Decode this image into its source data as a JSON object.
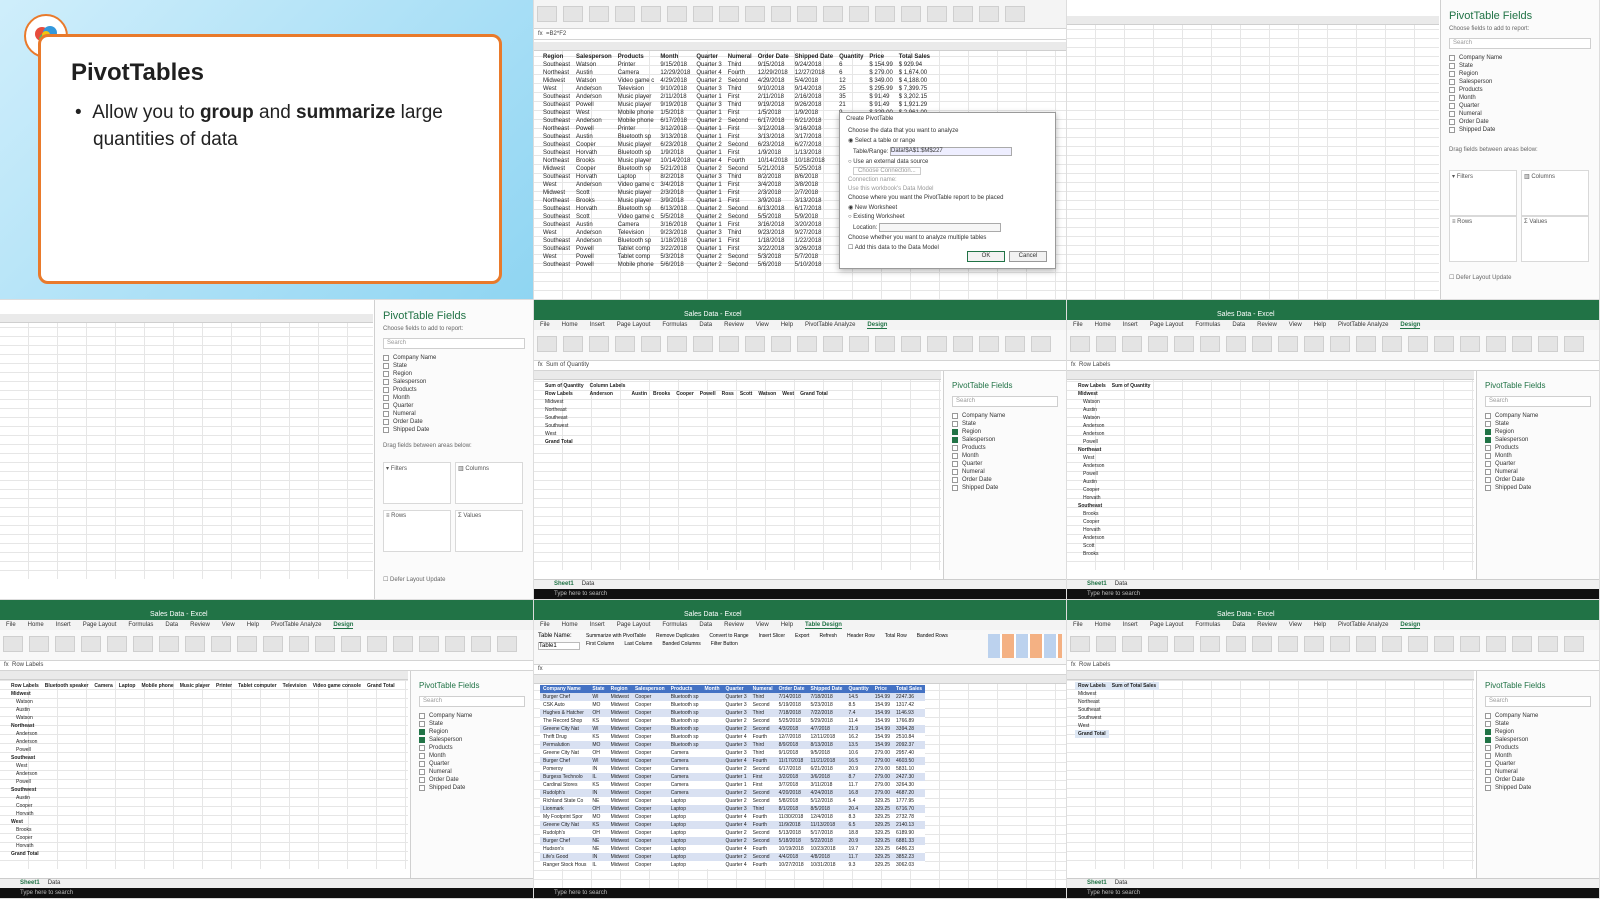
{
  "slide": {
    "title": "PivotTables",
    "bullet_pre": "Allow you to ",
    "bullet_b1": "group",
    "bullet_mid": " and ",
    "bullet_b2": "summarize",
    "bullet_post": " large quantities of data"
  },
  "excel": {
    "title_sales": "Sales Data - Excel",
    "formula_value": "=B2*F2",
    "formula_sum": "Sum of Quantity",
    "formula_rl": "Row Labels",
    "menu": [
      "File",
      "Home",
      "Insert",
      "Page Layout",
      "Formulas",
      "Data",
      "Review",
      "View",
      "Help",
      "PivotTable Analyze",
      "Design"
    ],
    "menu_table": [
      "File",
      "Home",
      "Insert",
      "Page Layout",
      "Formulas",
      "Data",
      "Review",
      "View",
      "Help",
      "Table Design"
    ],
    "sheet_tabs": [
      "Sheet1",
      "Data"
    ],
    "taskbar_search": "Type here to search"
  },
  "panel": {
    "title": "PivotTable Fields",
    "subtitle": "Choose fields to add to report:",
    "search": "Search",
    "fields": [
      "Company Name",
      "State",
      "Region",
      "Salesperson",
      "Products",
      "Month",
      "Quarter",
      "Numeral",
      "Order Date",
      "Shipped Date"
    ],
    "areas": {
      "filters": "Filters",
      "columns": "Columns",
      "rows": "Rows",
      "values": "Values"
    },
    "drag": "Drag fields between areas below:",
    "defer": "Defer Layout Update",
    "update": "Update"
  },
  "data_table": {
    "headers": [
      "Region",
      "Salesperson",
      "Products",
      "Month",
      "Quarter",
      "Numeral",
      "Order Date",
      "Shipped Date",
      "Quantity",
      "Price",
      "Total Sales"
    ],
    "rows": [
      [
        "Southeast",
        "Watson",
        "Printer",
        "9/15/2018",
        "Quarter 3",
        "Third",
        "9/15/2018",
        "9/24/2018",
        "6",
        "$ 154.99",
        "$ 929.94"
      ],
      [
        "Northeast",
        "Austin",
        "Camera",
        "12/29/2018",
        "Quarter 4",
        "Fourth",
        "12/29/2018",
        "12/27/2018",
        "6",
        "$ 279.00",
        "$ 1,674.00"
      ],
      [
        "Midwest",
        "Watson",
        "Video game c",
        "4/29/2018",
        "Quarter 2",
        "Second",
        "4/29/2018",
        "5/4/2018",
        "12",
        "$ 349.00",
        "$ 4,188.00"
      ],
      [
        "West",
        "Anderson",
        "Television",
        "9/10/2018",
        "Quarter 3",
        "Third",
        "9/10/2018",
        "9/14/2018",
        "25",
        "$ 295.99",
        "$ 7,399.75"
      ],
      [
        "Southeast",
        "Anderson",
        "Music player",
        "2/11/2018",
        "Quarter 1",
        "First",
        "2/11/2018",
        "2/16/2018",
        "35",
        "$ 91.49",
        "$ 3,202.15"
      ],
      [
        "Southeast",
        "Powell",
        "Music player",
        "9/19/2018",
        "Quarter 3",
        "Third",
        "9/19/2018",
        "9/26/2018",
        "21",
        "$ 91.49",
        "$ 1,921.29"
      ],
      [
        "Southeast",
        "West",
        "Mobile phone",
        "1/5/2018",
        "Quarter 1",
        "First",
        "1/5/2018",
        "1/9/2018",
        "9",
        "$ 329.00",
        "$ 2,961.00"
      ],
      [
        "Southeast",
        "Anderson",
        "Mobile phone",
        "6/17/2018",
        "Quarter 2",
        "Second",
        "6/17/2018",
        "6/21/2018",
        "14",
        "$ 329.00",
        "$ 4,606.00"
      ],
      [
        "Northeast",
        "Powell",
        "Printer",
        "3/12/2018",
        "Quarter 1",
        "First",
        "3/12/2018",
        "3/16/2018",
        "18",
        "$ 154.99",
        "$ 2,789.82"
      ],
      [
        "Southeast",
        "Austin",
        "Bluetooth sp",
        "3/13/2018",
        "Quarter 1",
        "First",
        "3/13/2018",
        "3/17/2018",
        "7",
        "$ 54.99",
        "$ 384.93"
      ],
      [
        "Southeast",
        "Cooper",
        "Music player",
        "6/23/2018",
        "Quarter 2",
        "Second",
        "6/23/2018",
        "6/27/2018",
        "11",
        "$ 91.49",
        "$ 1,006.39"
      ],
      [
        "Southeast",
        "Horvath",
        "Bluetooth sp",
        "1/9/2018",
        "Quarter 1",
        "First",
        "1/9/2018",
        "1/13/2018",
        "15",
        "$ 54.99",
        "$ 824.85"
      ],
      [
        "Northeast",
        "Brooks",
        "Music player",
        "10/14/2018",
        "Quarter 4",
        "Fourth",
        "10/14/2018",
        "10/18/2018",
        "20",
        "$ 91.49",
        "$ 1,829.80"
      ],
      [
        "Midwest",
        "Cooper",
        "Bluetooth sp",
        "5/21/2018",
        "Quarter 2",
        "Second",
        "5/21/2018",
        "5/25/2018",
        "8",
        "$ 54.99",
        "$ 439.92"
      ],
      [
        "Southeast",
        "Horvath",
        "Laptop",
        "8/2/2018",
        "Quarter 3",
        "Third",
        "8/2/2018",
        "8/6/2018",
        "4",
        "$ 629.00",
        "$ 2,516.00"
      ],
      [
        "West",
        "Anderson",
        "Video game c",
        "3/4/2018",
        "Quarter 1",
        "First",
        "3/4/2018",
        "3/8/2018",
        "10",
        "$ 349.00",
        "$ 3,490.00"
      ],
      [
        "Midwest",
        "Scott",
        "Music player",
        "2/3/2018",
        "Quarter 1",
        "First",
        "2/3/2018",
        "2/7/2018",
        "13",
        "$ 91.49",
        "$ 1,189.37"
      ],
      [
        "Northeast",
        "Brooks",
        "Music player",
        "3/9/2018",
        "Quarter 1",
        "First",
        "3/9/2018",
        "3/13/2018",
        "16",
        "$ 91.49",
        "$ 1,463.84"
      ],
      [
        "Southeast",
        "Horvath",
        "Bluetooth sp",
        "6/13/2018",
        "Quarter 2",
        "Second",
        "6/13/2018",
        "6/17/2018",
        "22",
        "$ 54.99",
        "$ 1,209.78"
      ],
      [
        "Southeast",
        "Scott",
        "Video game c",
        "5/5/2018",
        "Quarter 2",
        "Second",
        "5/5/2018",
        "5/9/2018",
        "5",
        "$ 349.00",
        "$ 1,745.00"
      ],
      [
        "Southeast",
        "Austin",
        "Camera",
        "3/16/2018",
        "Quarter 1",
        "First",
        "3/16/2018",
        "3/20/2018",
        "3",
        "$ 279.00",
        "$ 837.00"
      ],
      [
        "West",
        "Anderson",
        "Television",
        "9/23/2018",
        "Quarter 3",
        "Third",
        "9/23/2018",
        "9/27/2018",
        "19",
        "$ 295.99",
        "$ 5,623.81"
      ],
      [
        "Southeast",
        "Anderson",
        "Bluetooth sp",
        "1/18/2018",
        "Quarter 1",
        "First",
        "1/18/2018",
        "1/22/2018",
        "12",
        "$ 54.99",
        "$ 659.88"
      ],
      [
        "Southeast",
        "Powell",
        "Tablet comp",
        "3/22/2018",
        "Quarter 1",
        "First",
        "3/22/2018",
        "3/26/2018",
        "27",
        "$ 325.00",
        "$ 8,775.00"
      ],
      [
        "West",
        "Powell",
        "Tablet comp",
        "5/3/2018",
        "Quarter 2",
        "Second",
        "5/3/2018",
        "5/7/2018",
        "24",
        "$ 325.00",
        "$ 7,800.00"
      ],
      [
        "Southeast",
        "Powell",
        "Mobile phone",
        "5/6/2018",
        "Quarter 2",
        "Second",
        "5/6/2018",
        "5/10/2018",
        "9",
        "$ 329.00",
        "$ 2,961.00"
      ]
    ]
  },
  "dialog": {
    "title": "Create PivotTable",
    "choose": "Choose the data that you want to analyze",
    "opt1": "Select a table or range",
    "range_label": "Table/Range:",
    "range_value": "Data!$A$1:$M$227",
    "opt2": "Use an external data source",
    "conn_btn": "Choose Connection...",
    "conn_name": "Connection name:",
    "model": "Use this workbook's Data Model",
    "place": "Choose where you want the PivotTable report to be placed",
    "new_ws": "New Worksheet",
    "exist_ws": "Existing Worksheet",
    "location": "Location:",
    "multi": "Choose whether you want to analyze multiple tables",
    "add_model": "Add this data to the Data Model",
    "ok": "OK",
    "cancel": "Cancel"
  },
  "pivot_sum": {
    "header": [
      "Sum of Quantity",
      "Column Labels"
    ],
    "cols": [
      "Row Labels",
      "Anderson",
      "Austin",
      "Brooks",
      "Cooper",
      "Powell",
      "Ross",
      "Scott",
      "Watson",
      "West",
      "Grand Total"
    ],
    "rows": [
      [
        "Midwest",
        "",
        "",
        "",
        "",
        "",
        "",
        "",
        "",
        "",
        ""
      ],
      [
        "Northeast",
        "",
        "",
        "",
        "",
        "",
        "",
        "",
        "",
        "",
        ""
      ],
      [
        "Southeast",
        "",
        "",
        "",
        "",
        "",
        "",
        "",
        "",
        "",
        ""
      ],
      [
        "Southwest",
        "",
        "",
        "",
        "",
        "",
        "",
        "",
        "",
        "",
        ""
      ],
      [
        "West",
        "",
        "",
        "",
        "",
        "",
        "",
        "",
        "",
        "",
        ""
      ],
      [
        "Grand Total",
        "",
        "",
        "",
        "",
        "",
        "",
        "",
        "",
        "",
        ""
      ]
    ]
  },
  "pivot_rows": {
    "header": [
      "Row Labels",
      "Sum of Quantity"
    ],
    "groups": [
      "Midwest",
      "Northeast",
      "Southeast"
    ]
  },
  "pivot_products": {
    "cols": [
      "Row Labels",
      "Bluetooth speaker",
      "Camera",
      "Laptop",
      "Mobile phone",
      "Music player",
      "Printer",
      "Tablet computer",
      "Television",
      "Video game console",
      "Grand Total"
    ],
    "groups": [
      "Midwest",
      "Northeast",
      "Southeast",
      "Southwest",
      "West",
      "Grand Total"
    ]
  },
  "table_design": {
    "menu_active": "Table Design",
    "table_name_label": "Table Name:",
    "table_name": "Table1",
    "tools": [
      "Summarize with PivotTable",
      "Remove Duplicates",
      "Convert to Range",
      "Insert Slicer",
      "Export",
      "Refresh",
      "Header Row",
      "Total Row",
      "Banded Rows",
      "First Column",
      "Last Column",
      "Banded Columns",
      "Filter Button"
    ],
    "headers": [
      "Company Name",
      "State",
      "Region",
      "Salesperson",
      "Products",
      "Month",
      "Quarter",
      "Numeral",
      "Order Date",
      "Shipped Date",
      "Quantity",
      "Price",
      "Total Sales"
    ],
    "rows": [
      [
        "Burger Chef",
        "WI",
        "Midwest",
        "Cooper",
        "Bluetooth sp",
        "",
        "Quarter 3",
        "Third",
        "7/14/2018",
        "7/18/2018",
        "14.5",
        "154.99",
        "2247.36"
      ],
      [
        "CSK Auto",
        "MO",
        "Midwest",
        "Cooper",
        "Bluetooth sp",
        "",
        "Quarter 3",
        "Second",
        "5/19/2018",
        "5/23/2018",
        "8.5",
        "154.99",
        "1317.42"
      ],
      [
        "Hughes & Hatcher",
        "OH",
        "Midwest",
        "Cooper",
        "Bluetooth sp",
        "",
        "Quarter 3",
        "Third",
        "7/18/2018",
        "7/22/2018",
        "7.4",
        "154.99",
        "1146.93"
      ],
      [
        "The Record Shop",
        "KS",
        "Midwest",
        "Cooper",
        "Bluetooth sp",
        "",
        "Quarter 2",
        "Second",
        "5/25/2018",
        "5/29/2018",
        "11.4",
        "154.99",
        "1766.89"
      ],
      [
        "Greene City Nat",
        "WI",
        "Midwest",
        "Cooper",
        "Bluetooth sp",
        "",
        "Quarter 2",
        "Second",
        "4/3/2018",
        "4/7/2018",
        "21.9",
        "154.99",
        "3394.28"
      ],
      [
        "Thrift Drug",
        "KS",
        "Midwest",
        "Cooper",
        "Bluetooth sp",
        "",
        "Quarter 4",
        "Fourth",
        "12/7/2018",
        "12/11/2018",
        "16.2",
        "154.99",
        "2510.84"
      ],
      [
        "Permalution",
        "MO",
        "Midwest",
        "Cooper",
        "Bluetooth sp",
        "",
        "Quarter 3",
        "Third",
        "8/9/2018",
        "8/13/2018",
        "13.5",
        "154.99",
        "2092.37"
      ],
      [
        "Greene City Nat",
        "OH",
        "Midwest",
        "Cooper",
        "Camera",
        "",
        "Quarter 3",
        "Third",
        "9/1/2018",
        "9/5/2018",
        "10.6",
        "279.00",
        "2957.40"
      ],
      [
        "Burger Chef",
        "WI",
        "Midwest",
        "Cooper",
        "Camera",
        "",
        "Quarter 4",
        "Fourth",
        "11/17/2018",
        "11/21/2018",
        "16.5",
        "279.00",
        "4603.50"
      ],
      [
        "Pomeroy",
        "IN",
        "Midwest",
        "Cooper",
        "Camera",
        "",
        "Quarter 2",
        "Second",
        "6/17/2018",
        "6/21/2018",
        "20.9",
        "279.00",
        "5831.10"
      ],
      [
        "Burgess Technolo",
        "IL",
        "Midwest",
        "Cooper",
        "Camera",
        "",
        "Quarter 1",
        "First",
        "3/2/2018",
        "3/6/2018",
        "8.7",
        "279.00",
        "2427.30"
      ],
      [
        "Cardinal Stores",
        "KS",
        "Midwest",
        "Cooper",
        "Camera",
        "",
        "Quarter 1",
        "First",
        "3/7/2018",
        "3/11/2018",
        "11.7",
        "279.00",
        "3264.30"
      ],
      [
        "Rudolph's",
        "IN",
        "Midwest",
        "Cooper",
        "Camera",
        "",
        "Quarter 2",
        "Second",
        "4/20/2018",
        "4/24/2018",
        "16.8",
        "279.00",
        "4687.20"
      ],
      [
        "Richland State Co",
        "NE",
        "Midwest",
        "Cooper",
        "Laptop",
        "",
        "Quarter 2",
        "Second",
        "5/8/2018",
        "5/12/2018",
        "5.4",
        "329.25",
        "1777.95"
      ],
      [
        "Lionmark",
        "OH",
        "Midwest",
        "Cooper",
        "Laptop",
        "",
        "Quarter 3",
        "Third",
        "8/1/2018",
        "8/5/2018",
        "20.4",
        "329.25",
        "6716.70"
      ],
      [
        "My Footprint Spor",
        "MO",
        "Midwest",
        "Cooper",
        "Laptop",
        "",
        "Quarter 4",
        "Fourth",
        "11/30/2018",
        "12/4/2018",
        "8.3",
        "329.25",
        "2732.78"
      ],
      [
        "Greene City Nat",
        "KS",
        "Midwest",
        "Cooper",
        "Laptop",
        "",
        "Quarter 4",
        "Fourth",
        "11/9/2018",
        "11/13/2018",
        "6.5",
        "329.25",
        "2140.13"
      ],
      [
        "Rudolph's",
        "OH",
        "Midwest",
        "Cooper",
        "Laptop",
        "",
        "Quarter 2",
        "Second",
        "5/13/2018",
        "5/17/2018",
        "18.8",
        "329.25",
        "6189.90"
      ],
      [
        "Burger Chef",
        "NE",
        "Midwest",
        "Cooper",
        "Laptop",
        "",
        "Quarter 2",
        "Second",
        "5/18/2018",
        "5/22/2018",
        "20.9",
        "329.25",
        "6881.33"
      ],
      [
        "Hudson's",
        "NE",
        "Midwest",
        "Cooper",
        "Laptop",
        "",
        "Quarter 4",
        "Fourth",
        "10/19/2018",
        "10/23/2018",
        "19.7",
        "329.25",
        "6486.23"
      ],
      [
        "Life's Good",
        "IN",
        "Midwest",
        "Cooper",
        "Laptop",
        "",
        "Quarter 2",
        "Second",
        "4/4/2018",
        "4/8/2018",
        "11.7",
        "329.25",
        "3852.23"
      ],
      [
        "Ranger Stock Hous",
        "IL",
        "Midwest",
        "Cooper",
        "Laptop",
        "",
        "Quarter 4",
        "Fourth",
        "10/27/2018",
        "10/31/2018",
        "9.3",
        "329.25",
        "3062.03"
      ]
    ]
  },
  "pivot_regions": {
    "header": [
      "Row Labels",
      "Sum of Total Sales"
    ],
    "rows": [
      "Midwest",
      "Northeast",
      "Southeast",
      "Southwest",
      "West",
      "Grand Total"
    ]
  }
}
